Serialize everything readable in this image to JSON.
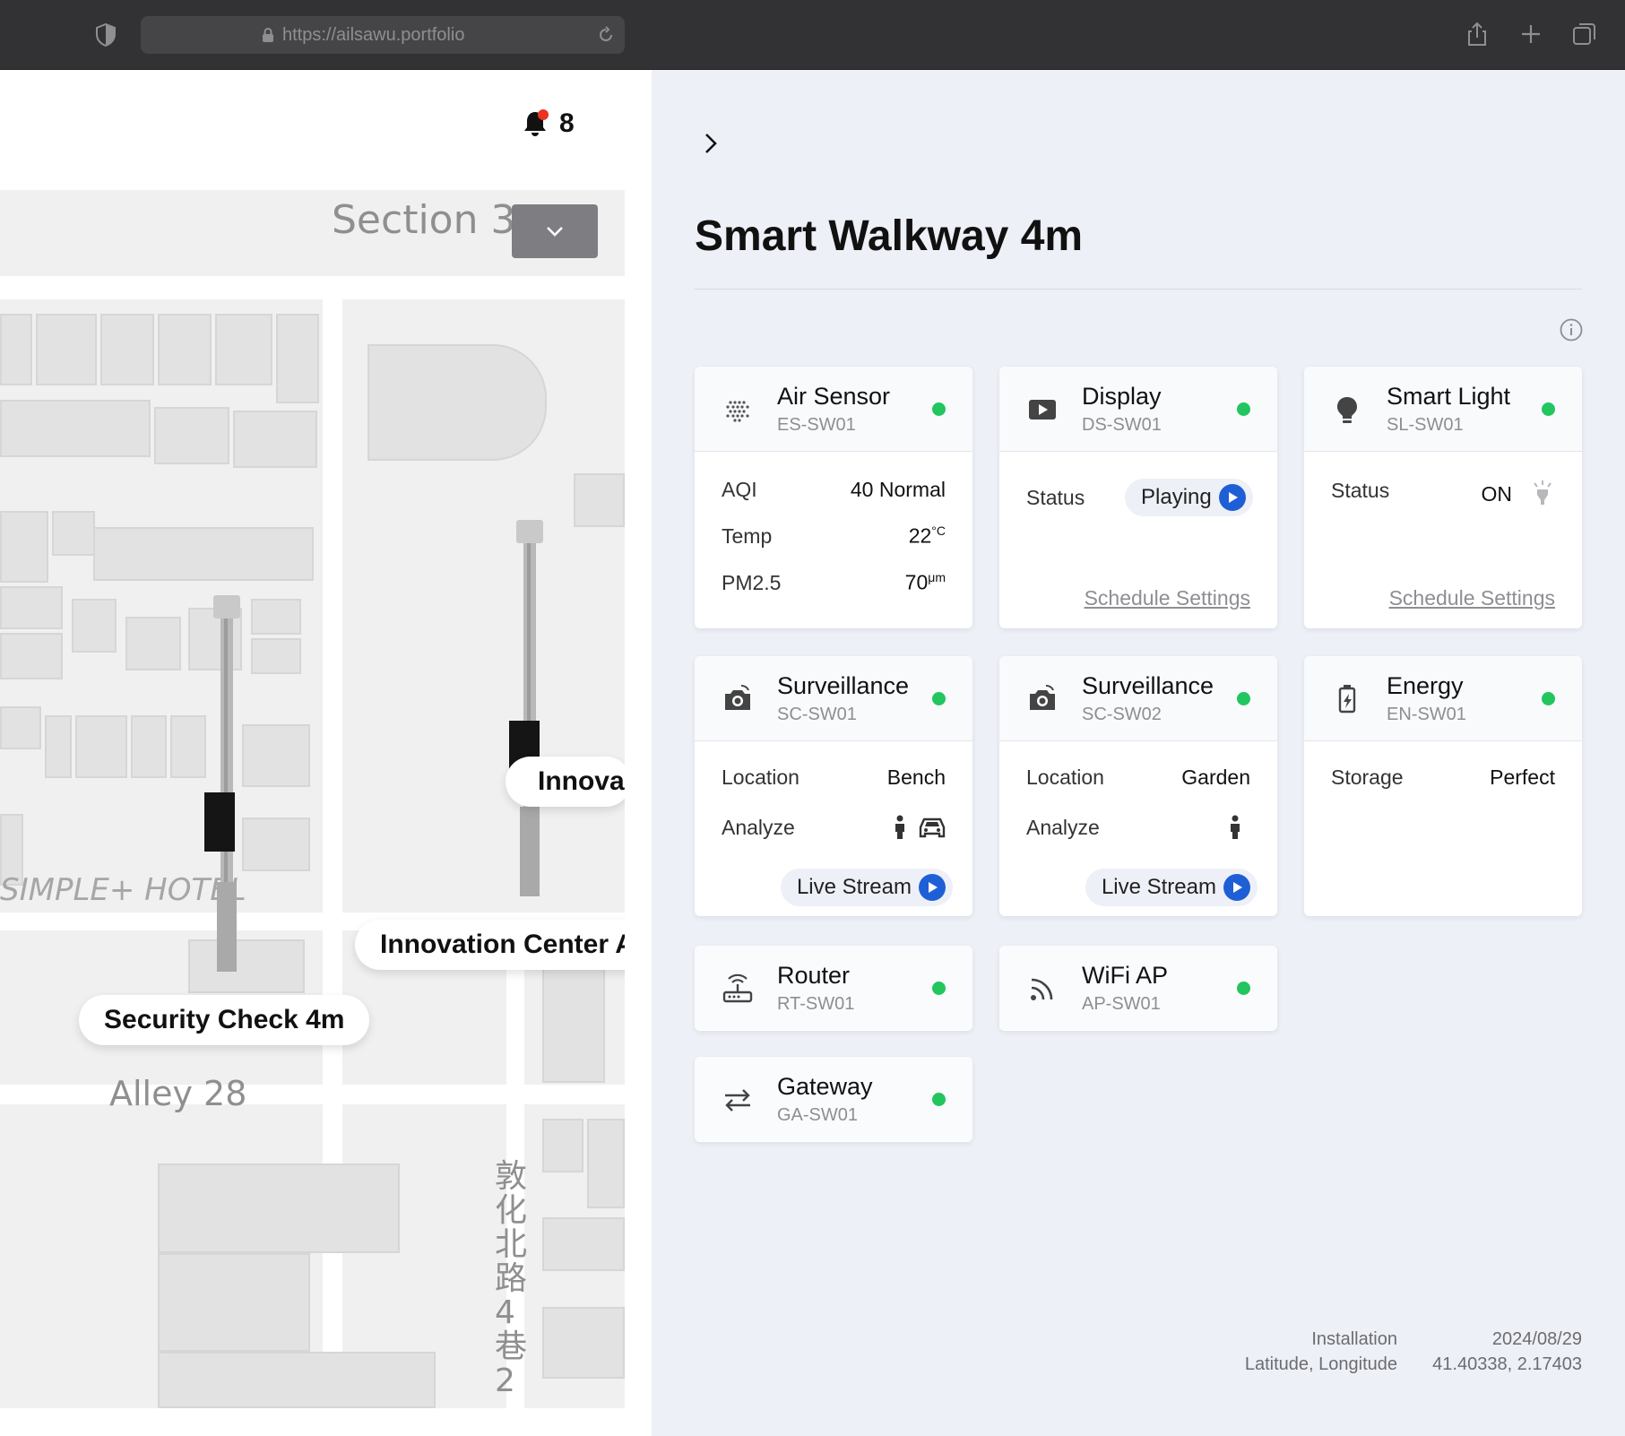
{
  "browser": {
    "url": "https://ailsawu.portfolio"
  },
  "notifications": {
    "count": "8"
  },
  "map": {
    "section": "Section 3",
    "labels": {
      "hotel": "SIMPLE+ HOTEL",
      "alley": "Alley 28",
      "street": "敦化北路4巷2"
    },
    "pins": [
      {
        "label": "Security Check 4m"
      },
      {
        "label": "Innovation Center A"
      },
      {
        "label": "Innovati"
      }
    ]
  },
  "panel": {
    "title": "Smart Walkway 4m",
    "devices": {
      "air_sensor": {
        "name": "Air Sensor",
        "id": "ES-SW01",
        "rows": [
          {
            "key": "AQI",
            "value": "40 Normal"
          },
          {
            "key": "Temp",
            "value": "22",
            "unit": "°C"
          },
          {
            "key": "PM2.5",
            "value": "70",
            "unit": "μm"
          }
        ]
      },
      "display": {
        "name": "Display",
        "id": "DS-SW01",
        "status_label": "Status",
        "status_value": "Playing",
        "link": "Schedule Settings"
      },
      "smart_light": {
        "name": "Smart Light",
        "id": "SL-SW01",
        "status_label": "Status",
        "status_value": "ON",
        "link": "Schedule Settings"
      },
      "surveillance1": {
        "name": "Surveillance",
        "id": "SC-SW01",
        "location_label": "Location",
        "location_value": "Bench",
        "analyze_label": "Analyze",
        "stream": "Live Stream"
      },
      "surveillance2": {
        "name": "Surveillance",
        "id": "SC-SW02",
        "location_label": "Location",
        "location_value": "Garden",
        "analyze_label": "Analyze",
        "stream": "Live Stream"
      },
      "energy": {
        "name": "Energy",
        "id": "EN-SW01",
        "storage_label": "Storage",
        "storage_value": "Perfect"
      },
      "router": {
        "name": "Router",
        "id": "RT-SW01"
      },
      "wifi": {
        "name": "WiFi AP",
        "id": "AP-SW01"
      },
      "gateway": {
        "name": "Gateway",
        "id": "GA-SW01"
      }
    },
    "footer": {
      "installation_label": "Installation",
      "installation_value": "2024/08/29",
      "coords_label": "Latitude, Longitude",
      "coords_value": "41.40338, 2.17403"
    }
  },
  "colors": {
    "status_online": "#22c55e",
    "play_blue": "#1f5fd6",
    "notification_dot": "#ea3323"
  }
}
